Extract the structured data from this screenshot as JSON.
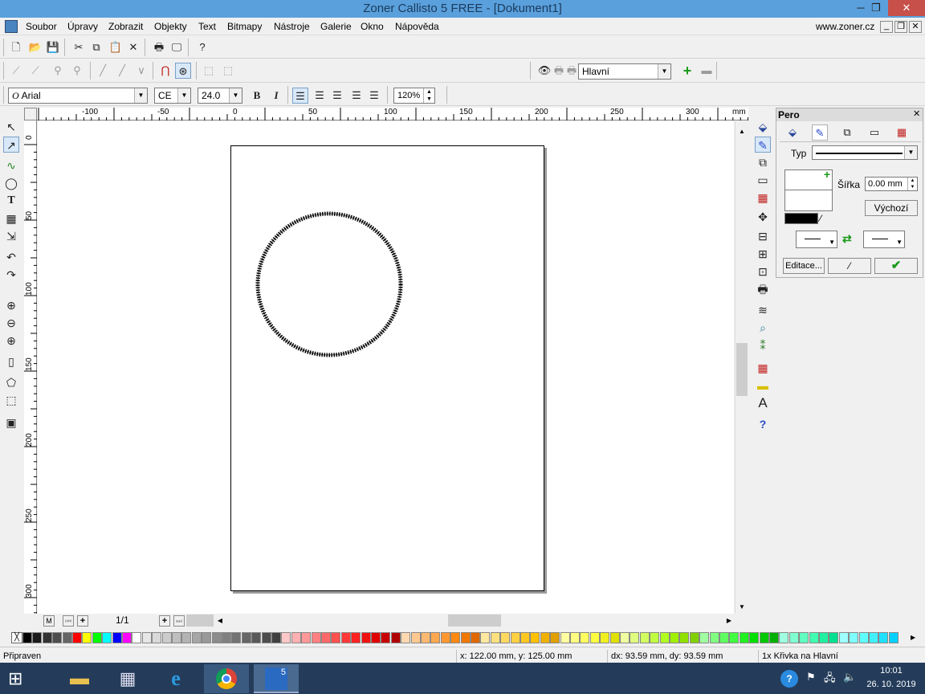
{
  "window": {
    "title": "Zoner Callisto 5 FREE - [Dokument1]",
    "website": "www.zoner.cz"
  },
  "menu": [
    "Soubor",
    "Úpravy",
    "Zobrazit",
    "Objekty",
    "Text",
    "Bitmapy",
    "Nástroje",
    "Galerie",
    "Okno",
    "Nápověda"
  ],
  "layers": {
    "current": "Hlavní"
  },
  "text_toolbar": {
    "font": "Arial",
    "charset": "CE",
    "size": "24.0",
    "zoom": "120%"
  },
  "ruler": {
    "h_labels": [
      "-100",
      "-50",
      "0",
      "50",
      "100",
      "150",
      "200",
      "250",
      "300",
      "mm"
    ],
    "v_labels": [
      "0",
      "50",
      "100",
      "150",
      "200",
      "250",
      "300"
    ]
  },
  "page_nav": {
    "counter": "1/1",
    "master": "M"
  },
  "pen_panel": {
    "title": "Pero",
    "type_label": "Typ",
    "width_label": "Šířka",
    "width_value": "0.00 mm",
    "default_button": "Výchozí",
    "edit_button": "Editace..."
  },
  "status": {
    "state": "Připraven",
    "coords": "x: 122.00 mm, y: 125.00 mm",
    "delta": "dx: 93.59 mm, dy: 93.59 mm",
    "selection": "1x Křivka na Hlavní"
  },
  "taskbar": {
    "time": "10:01",
    "date": "26. 10. 2019"
  },
  "palette": [
    "#000000",
    "#1a1a1a",
    "#333333",
    "#4d4d4d",
    "#666666",
    "#ff0000",
    "#ffff00",
    "#00ff00",
    "#00ffff",
    "#0000ff",
    "#ff00ff",
    "#ffffff",
    "#e6e6e6",
    "#d9d9d9",
    "#cccccc",
    "#bfbfbf",
    "#b3b3b3",
    "#a6a6a6",
    "#999999",
    "#8c8c8c",
    "#808080",
    "#737373",
    "#666666",
    "#595959",
    "#4d4d4d",
    "#404040",
    "#ffc8c8",
    "#ffb0b0",
    "#ff9898",
    "#ff8080",
    "#ff6868",
    "#ff5050",
    "#ff3838",
    "#ff2020",
    "#f01010",
    "#e00000",
    "#c80000",
    "#b00000",
    "#ffd8b0",
    "#ffc890",
    "#ffb870",
    "#ffa850",
    "#ff9830",
    "#ff8810",
    "#f07800",
    "#e06800",
    "#ffe8a0",
    "#ffe080",
    "#ffd860",
    "#ffd040",
    "#ffc820",
    "#ffc000",
    "#f0b000",
    "#e0a000",
    "#ffffa0",
    "#ffff80",
    "#ffff60",
    "#ffff40",
    "#f0f020",
    "#e0e000",
    "#f0ffa0",
    "#e0ff80",
    "#d0ff60",
    "#c0ff40",
    "#b0ff20",
    "#a0f000",
    "#90e000",
    "#80d000",
    "#a0ffa0",
    "#80ff80",
    "#60ff60",
    "#40ff40",
    "#20f020",
    "#00e000",
    "#00c800",
    "#00b000",
    "#a0ffe0",
    "#80ffd0",
    "#60ffc0",
    "#40ffb0",
    "#20f0a0",
    "#00e090",
    "#a0ffff",
    "#80ffff",
    "#60ffff",
    "#40f0ff",
    "#20e0ff",
    "#00d0ff"
  ]
}
